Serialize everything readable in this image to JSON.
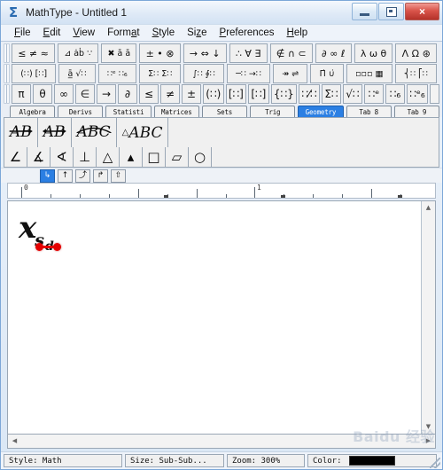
{
  "window": {
    "title": "MathType - Untitled 1",
    "app_icon": "sigma-icon",
    "buttons": {
      "minimize": "minimize-icon",
      "restore": "restore-icon",
      "close": "×"
    }
  },
  "menubar": {
    "items": [
      {
        "label": "File",
        "mnemonic": "F"
      },
      {
        "label": "Edit",
        "mnemonic": "E"
      },
      {
        "label": "View",
        "mnemonic": "V"
      },
      {
        "label": "Format",
        "mnemonic": "a"
      },
      {
        "label": "Style",
        "mnemonic": "S"
      },
      {
        "label": "Size",
        "mnemonic": "z"
      },
      {
        "label": "Preferences",
        "mnemonic": "P"
      },
      {
        "label": "Help",
        "mnemonic": "H"
      }
    ]
  },
  "toolbar": {
    "row1": [
      "≤ ≠ ≈",
      "⊿ ȧḃ ∵",
      "✖ ā ā",
      "± • ⊗",
      "→ ⇔ ↓",
      "∴ ∀ ∃",
      "∉ ∩ ⊂",
      "∂ ∞ ℓ",
      "λ ω θ",
      "Λ Ω ⊛"
    ],
    "row2": [
      "(∷) [∷]",
      "ā̲ √∷",
      "∷ᵉ ∷₆",
      "Σ∷ Σ∷",
      "∫∷ ∮∷",
      "─∷ →∷",
      "↠ ⇌",
      "Π̇ ∪̇",
      "▫▫▫ ▦",
      "⎨∷ ⎡∷"
    ],
    "row3": [
      "π",
      "θ",
      "∞",
      "∈",
      "→",
      "∂",
      "≤",
      "≠",
      "±",
      "(∷)",
      "[∷]",
      "[∷]",
      "{∷}",
      "∷⁄∷",
      "Σ∷",
      "√∷",
      "∷ᵉ",
      "∷₆",
      "∷ᵉ₆"
    ]
  },
  "tabs": {
    "selected": "Geometry",
    "items": [
      "Algebra",
      "Derivs",
      "Statisti",
      "Matrices",
      "Sets",
      "Trig",
      "Geometry",
      "Tab 8",
      "Tab 9"
    ]
  },
  "palette": {
    "row1": [
      {
        "name": "vector-ab",
        "text": "AB",
        "over": "arrow-right"
      },
      {
        "name": "line-ab",
        "text": "AB",
        "over": "arrow-both"
      },
      {
        "name": "arc-abc",
        "text": "ABC",
        "over": "arc"
      },
      {
        "name": "triangle-abc",
        "text": "ABC",
        "prefix": "△"
      }
    ],
    "row2": [
      {
        "name": "angle",
        "glyph": "∠"
      },
      {
        "name": "measured-angle",
        "glyph": "∡"
      },
      {
        "name": "spherical-angle",
        "glyph": "∢"
      },
      {
        "name": "perpendicular",
        "glyph": "⊥"
      },
      {
        "name": "triangle",
        "glyph": "△"
      },
      {
        "name": "filled-triangle",
        "glyph": "▴"
      },
      {
        "name": "square",
        "glyph": "□"
      },
      {
        "name": "parallelogram",
        "glyph": "▱"
      },
      {
        "name": "circle",
        "glyph": "○"
      }
    ]
  },
  "size_strip": {
    "buttons": [
      "↳",
      "↑",
      "⤴",
      "↱",
      "⇧"
    ],
    "active_index": 0
  },
  "ruler": {
    "labels": [
      "0",
      "1"
    ],
    "unit": "in"
  },
  "document": {
    "formula": {
      "base": "x",
      "subscript": "s",
      "sub_subscript": "d"
    },
    "insertion_slot": {
      "name": "empty-slot",
      "color": "#e40000"
    }
  },
  "watermark": {
    "text": "Baidu 经验"
  },
  "statusbar": {
    "style_label": "Style: Math",
    "size_label": "Size: Sub-Sub...",
    "zoom_label": "Zoom: 300%",
    "color_label": "Color:",
    "color_value": "#000000"
  }
}
